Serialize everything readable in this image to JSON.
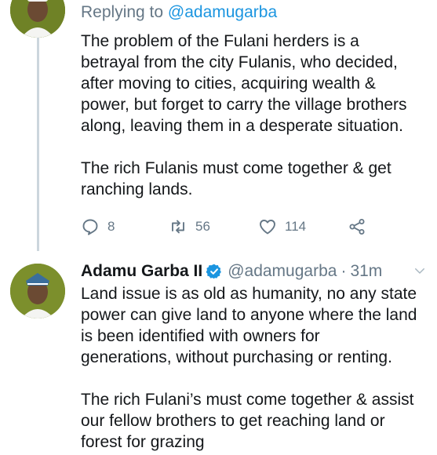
{
  "colors": {
    "accent": "#1b95e0",
    "text": "#14171a",
    "muted": "#657786",
    "thread": "#ccd6dd"
  },
  "first_tweet": {
    "reply_prefix": "Replying to ",
    "reply_handle": "@adamugarba",
    "paragraph_1": "The problem of the Fulani herders is a\nbetrayal from the city Fulanis, who decided,\nafter moving to cities, acquiring wealth &\npower, but forget to carry the village brothers\nalong, leaving them in a desperate situation.",
    "paragraph_2": "The rich Fulanis must come together & get\nranching lands.",
    "actions": {
      "reply_icon": "reply-icon",
      "reply_count": "8",
      "retweet_icon": "retweet-icon",
      "retweet_count": "56",
      "like_icon": "heart-icon",
      "like_count": "114",
      "share_icon": "share-icon"
    }
  },
  "second_tweet": {
    "name": "Adamu Garba II",
    "verified_icon": "verified-badge-icon",
    "handle": "@adamugarba",
    "separator": "·",
    "time": "31m",
    "menu_icon": "chevron-down-icon",
    "paragraph_1": "Land issue is as old as humanity, no any state\npower can give land to anyone where the land\nis been identified with owners for\ngenerations, without purchasing or renting.",
    "paragraph_2": "The rich Fulani’s must come together & assist\nour fellow brothers to get reaching land or\nforest for grazing"
  }
}
